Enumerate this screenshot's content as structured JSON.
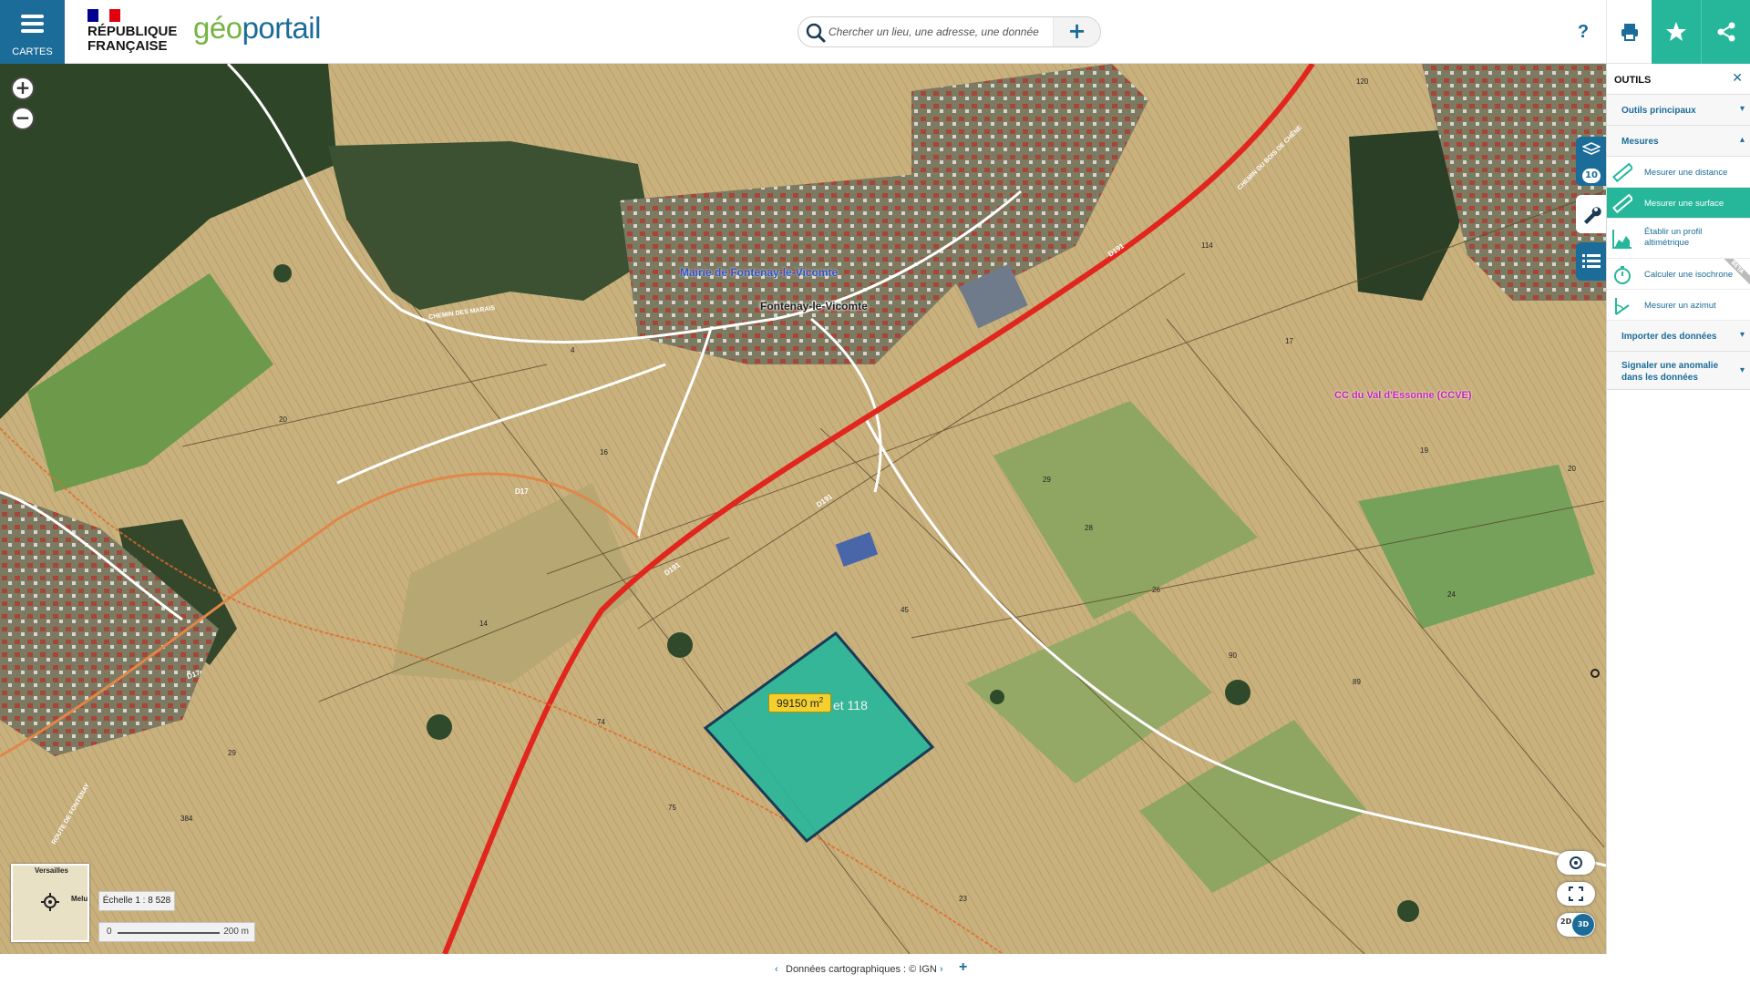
{
  "header": {
    "menu_label": "CARTES",
    "rf_line1": "RÉPUBLIQUE",
    "rf_line2": "FRANÇAISE",
    "logo_part1": "géo",
    "logo_part2": "portail",
    "search_placeholder": "Chercher un lieu, une adresse, une donnée",
    "help_label": "?",
    "colors": {
      "primary": "#1b6c98",
      "accent": "#26b79b",
      "logo_green": "#74b442"
    },
    "icons": [
      "menu-icon",
      "search-icon",
      "plus-icon",
      "help-icon",
      "print-icon",
      "star-icon",
      "share-icon"
    ]
  },
  "map": {
    "labels": {
      "mairie": "Mairie de Fontenay-le-Vicomte",
      "town": "Fontenay-le-Vicomte",
      "ccve": "CC du Val d'Essonne (CCVE)",
      "parcel_ref": "ZB 117 et 118",
      "road_d191_a": "D191",
      "road_d191_b": "D191",
      "road_d191_c": "D191",
      "road_d17_a": "D17",
      "road_d17_b": "D17",
      "chemin_marais": "CHEMIN DES MARAIS",
      "chemin_bois": "CHEMIN DU BOIS DE CHÊNE",
      "route_fontenay": "ROUTE DE FONTENAY"
    },
    "parcel_numbers": [
      "120",
      "114",
      "17",
      "19",
      "20",
      "29",
      "26",
      "28",
      "24",
      "90",
      "89",
      "45",
      "74",
      "75",
      "14",
      "16",
      "20",
      "29",
      "384",
      "23",
      "4"
    ],
    "measurement": {
      "value": "99150 m",
      "unit_exp": "2"
    },
    "overview": {
      "city_a": "Versailles",
      "city_b": "Melu"
    },
    "scale": {
      "ratio": "Échelle 1 : 8 528",
      "zero": "0",
      "length": "200 m"
    },
    "controls": {
      "zoom_in": "+",
      "zoom_out": "−",
      "toggle_2d": "2D",
      "toggle_3d": "3D"
    },
    "layers_badge": "10"
  },
  "panel": {
    "title": "OUTILS",
    "sections": {
      "main_tools": "Outils principaux",
      "measures": "Mesures",
      "import": "Importer des données",
      "report": "Signaler une anomalie dans les données"
    },
    "items": {
      "distance": "Mesurer une distance",
      "surface": "Mesurer une surface",
      "profil": "Établir un profil altimétrique",
      "isochrone": "Calculer une isochrone",
      "azimut": "Mesurer un azimut"
    },
    "beta_badge": "BETA"
  },
  "footer": {
    "prev": "‹",
    "attribution": "Données cartographiques : © IGN",
    "next": "›",
    "plus": "+"
  }
}
